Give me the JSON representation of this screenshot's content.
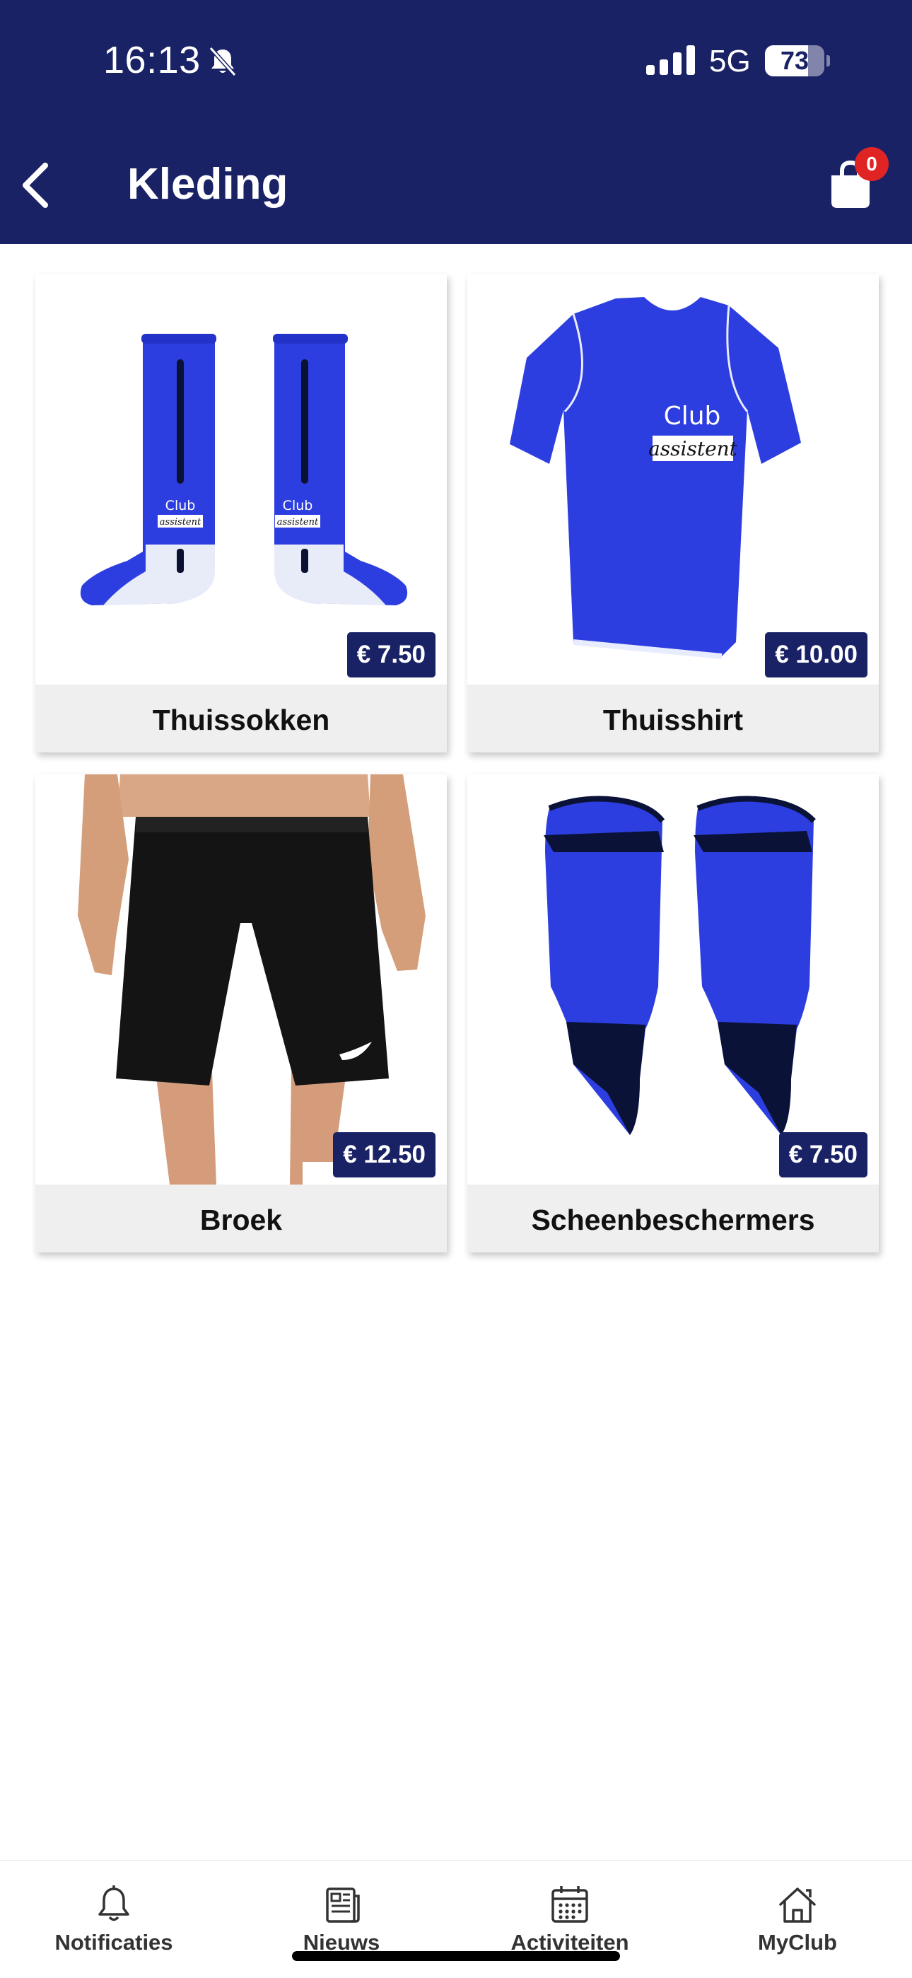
{
  "status_bar": {
    "time": "16:13",
    "network": "5G",
    "battery_level": "73",
    "battery_fraction": 0.73
  },
  "header": {
    "title": "Kleding",
    "cart_count": "0",
    "back_icon": "chevron-left-icon",
    "cart_icon": "shopping-bag-icon"
  },
  "products": [
    {
      "name": "Thuissokken",
      "price": "€ 7.50",
      "image": "socks"
    },
    {
      "name": "Thuisshirt",
      "price": "€ 10.00",
      "image": "shirt"
    },
    {
      "name": "Broek",
      "price": "€ 12.50",
      "image": "shorts"
    },
    {
      "name": "Scheenbeschermers",
      "price": "€ 7.50",
      "image": "shin-guards"
    }
  ],
  "product_branding": {
    "line1": "Club",
    "line2": "assistent"
  },
  "bottom_nav": [
    {
      "label": "Notificaties",
      "icon": "bell-icon"
    },
    {
      "label": "Nieuws",
      "icon": "newspaper-icon"
    },
    {
      "label": "Activiteiten",
      "icon": "calendar-icon"
    },
    {
      "label": "MyClub",
      "icon": "home-icon"
    }
  ],
  "colors": {
    "brand": "#1a2266",
    "badge": "#e02424",
    "product_blue": "#2d3ee0"
  }
}
